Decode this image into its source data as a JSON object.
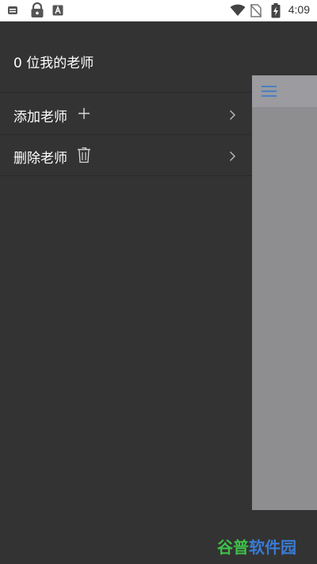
{
  "status_bar": {
    "time": "4:09",
    "icons": [
      "sim-icon",
      "lock-icon",
      "keyboard-a-icon",
      "wifi-icon",
      "no-sim-icon",
      "battery-charging-icon"
    ]
  },
  "drawer": {
    "title": "0 位我的老师",
    "items": [
      {
        "label": "添加老师",
        "icon": "plus-icon"
      },
      {
        "label": "删除老师",
        "icon": "trash-icon"
      }
    ]
  },
  "main": {
    "menu_icon": "hamburger-menu-icon"
  },
  "watermark": {
    "part1": "谷普",
    "part2": "软件园"
  },
  "colors": {
    "drawer_bg": "#333333",
    "main_bg": "#8e8e91",
    "menu_icon": "#4a7fc0",
    "watermark_green": "#3fbf4a",
    "watermark_blue": "#3a7bd5"
  }
}
